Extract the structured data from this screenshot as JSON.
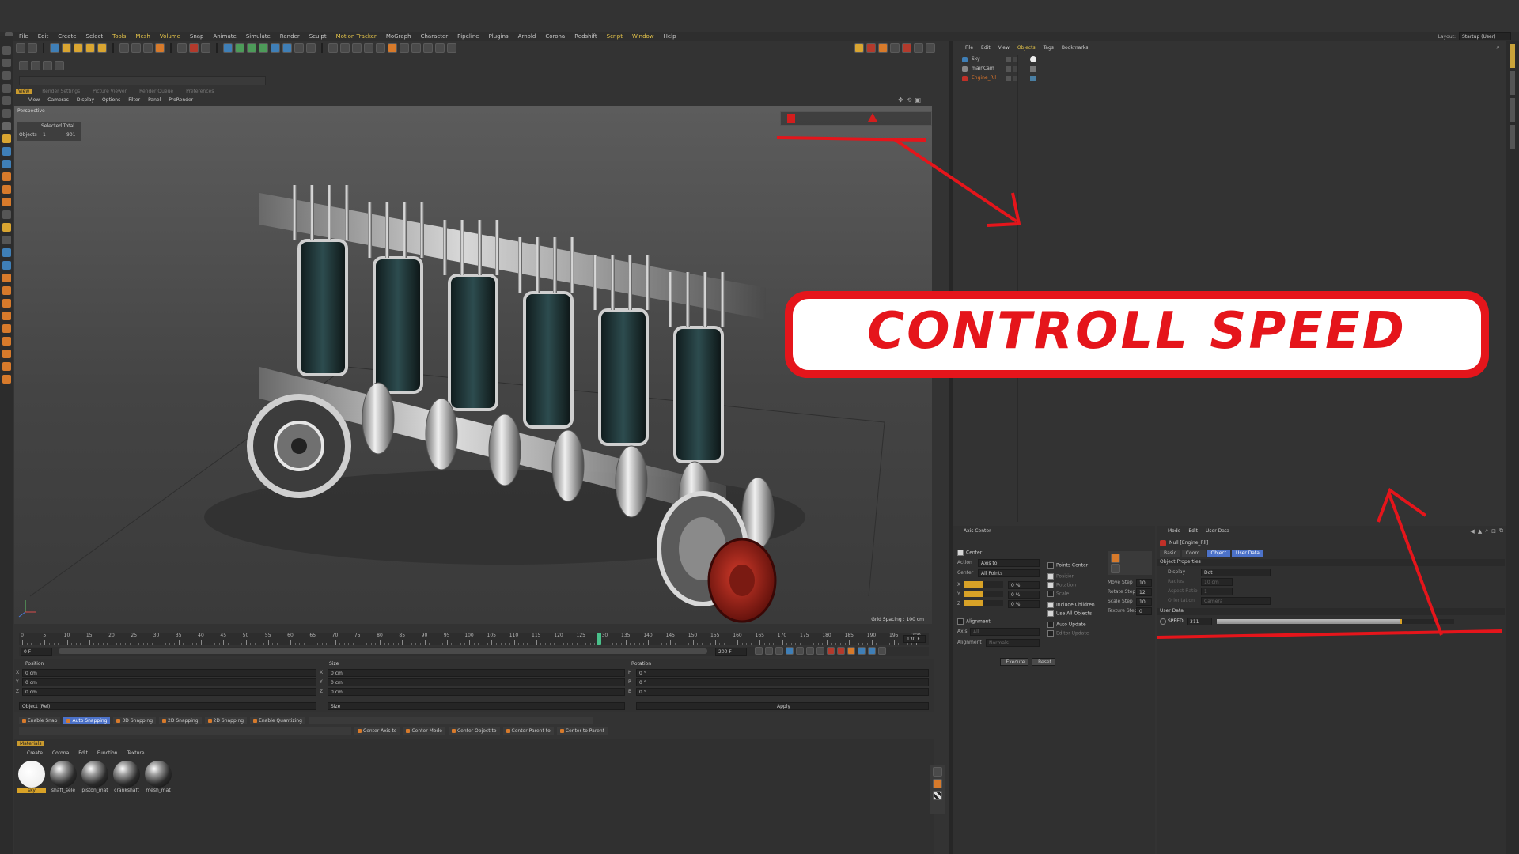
{
  "menubar": {
    "items": [
      "File",
      "Edit",
      "Create",
      "Select",
      "Tools",
      "Mesh",
      "Volume",
      "Snap",
      "Animate",
      "Simulate",
      "Render",
      "Sculpt",
      "Motion Tracker",
      "MoGraph",
      "Character",
      "Pipeline",
      "Plugins",
      "Arnold",
      "Corona",
      "Redshift",
      "Script",
      "Window",
      "Help"
    ],
    "layout_label": "Layout:",
    "layout_value": "Startup (User)"
  },
  "viewport": {
    "panel_tabs": [
      "View",
      "Render Settings",
      "Picture Viewer",
      "Render Queue",
      "Preferences"
    ],
    "menu": [
      "View",
      "Cameras",
      "Display",
      "Options",
      "Filter",
      "Panel",
      "ProRender"
    ],
    "name": "Perspective",
    "info_headers": "Selected Total",
    "info_row_label": "Objects",
    "info_selected": "1",
    "info_total": "901",
    "grid_spacing": "Grid Spacing : 100 cm"
  },
  "timeline": {
    "ticks": [
      "0",
      "5",
      "10",
      "15",
      "20",
      "25",
      "30",
      "35",
      "40",
      "45",
      "50",
      "55",
      "60",
      "65",
      "70",
      "75",
      "80",
      "85",
      "90",
      "95",
      "100",
      "105",
      "110",
      "115",
      "120",
      "125",
      "130",
      "135",
      "140",
      "145",
      "150",
      "155",
      "160",
      "165",
      "170",
      "175",
      "180",
      "185",
      "190",
      "195",
      "200"
    ],
    "current_frame": 129,
    "current_frame_label": "130 F",
    "start_field": "0 F",
    "end_field": "200 F"
  },
  "coords": {
    "headers": [
      "Position",
      "Size",
      "Rotation"
    ],
    "rows": [
      {
        "axis": "X",
        "pos": "0 cm",
        "size_axis": "X",
        "size": "0 cm",
        "rot_axis": "H",
        "rot": "0 °"
      },
      {
        "axis": "Y",
        "pos": "0 cm",
        "size_axis": "Y",
        "size": "0 cm",
        "rot_axis": "P",
        "rot": "0 °"
      },
      {
        "axis": "Z",
        "pos": "0 cm",
        "size_axis": "Z",
        "size": "0 cm",
        "rot_axis": "B",
        "rot": "0 °"
      }
    ],
    "mode_select": "Object (Rel)",
    "size_select": "Size",
    "apply": "Apply"
  },
  "snapping": {
    "row1": [
      "Enable Snap",
      "Auto Snapping",
      "3D Snapping",
      "2D Snapping",
      "2D Snapping",
      "Enable Quantizing"
    ],
    "row2": [
      "Center Axis to",
      "Center Mode",
      "Center Object to",
      "Center Parent to",
      "Center to Parent"
    ]
  },
  "materials": {
    "title": "Materials",
    "menu": [
      "Create",
      "Corona",
      "Edit",
      "Function",
      "Texture"
    ],
    "items": [
      "sky",
      "shaft_sele",
      "piston_mat",
      "crankshaft",
      "mesh_mat"
    ]
  },
  "objects": {
    "menu": [
      "File",
      "Edit",
      "View",
      "Objects",
      "Tags",
      "Bookmarks"
    ],
    "items": [
      "Sky",
      "mainCam",
      "Engine_Rll"
    ]
  },
  "axis_center": {
    "title": "Axis Center",
    "center_label": "Center",
    "action_label": "Action",
    "action_value": "Axis to",
    "center_value_label": "Center",
    "center_value": "All Points",
    "xyz": [
      {
        "axis": "X",
        "value": "0 %"
      },
      {
        "axis": "Y",
        "value": "0 %"
      },
      {
        "axis": "Z",
        "value": "0 %"
      }
    ],
    "points_center": "Points Center",
    "position": "Position",
    "rotation": "Rotation",
    "scale": "Scale",
    "include_children": "Include Children",
    "use_all_objects": "Use All Objects",
    "alignment": "Alignment",
    "axis_label": "Axis",
    "axis_value": "All",
    "alignment_label": "Alignment",
    "alignment_value": "Normals",
    "auto_update": "Auto Update",
    "editor_update": "Editor Update",
    "move_step": "Move Step",
    "move_step_v": "10",
    "rotate_step": "Rotate Step",
    "rotate_step_v": "12",
    "scale_step": "Scale Step",
    "scale_step_v": "10",
    "texture_step": "Texture Step",
    "texture_step_v": "0",
    "execute": "Execute",
    "reset": "Reset"
  },
  "attributes": {
    "menu": [
      "Mode",
      "Edit",
      "User Data"
    ],
    "object_name": "Null [Engine_Rll]",
    "tabs": [
      "Basic",
      "Coord.",
      "Object",
      "User Data"
    ],
    "active_tabs": [
      "Object",
      "User Data"
    ],
    "section_object": "Object Properties",
    "display_label": "Display",
    "display_value": "Dot",
    "radius_label": "Radius",
    "radius_value": "10 cm",
    "aspect_label": "Aspect Ratio",
    "aspect_value": "1",
    "orientation_label": "Orientation",
    "orientation_value": "Camera",
    "section_user": "User Data",
    "speed_label": "SPEED",
    "speed_value": "311",
    "speed_fill": 0.78
  },
  "overlay": {
    "title": "CONTROLL SPEED",
    "accent": "#e5151b"
  }
}
